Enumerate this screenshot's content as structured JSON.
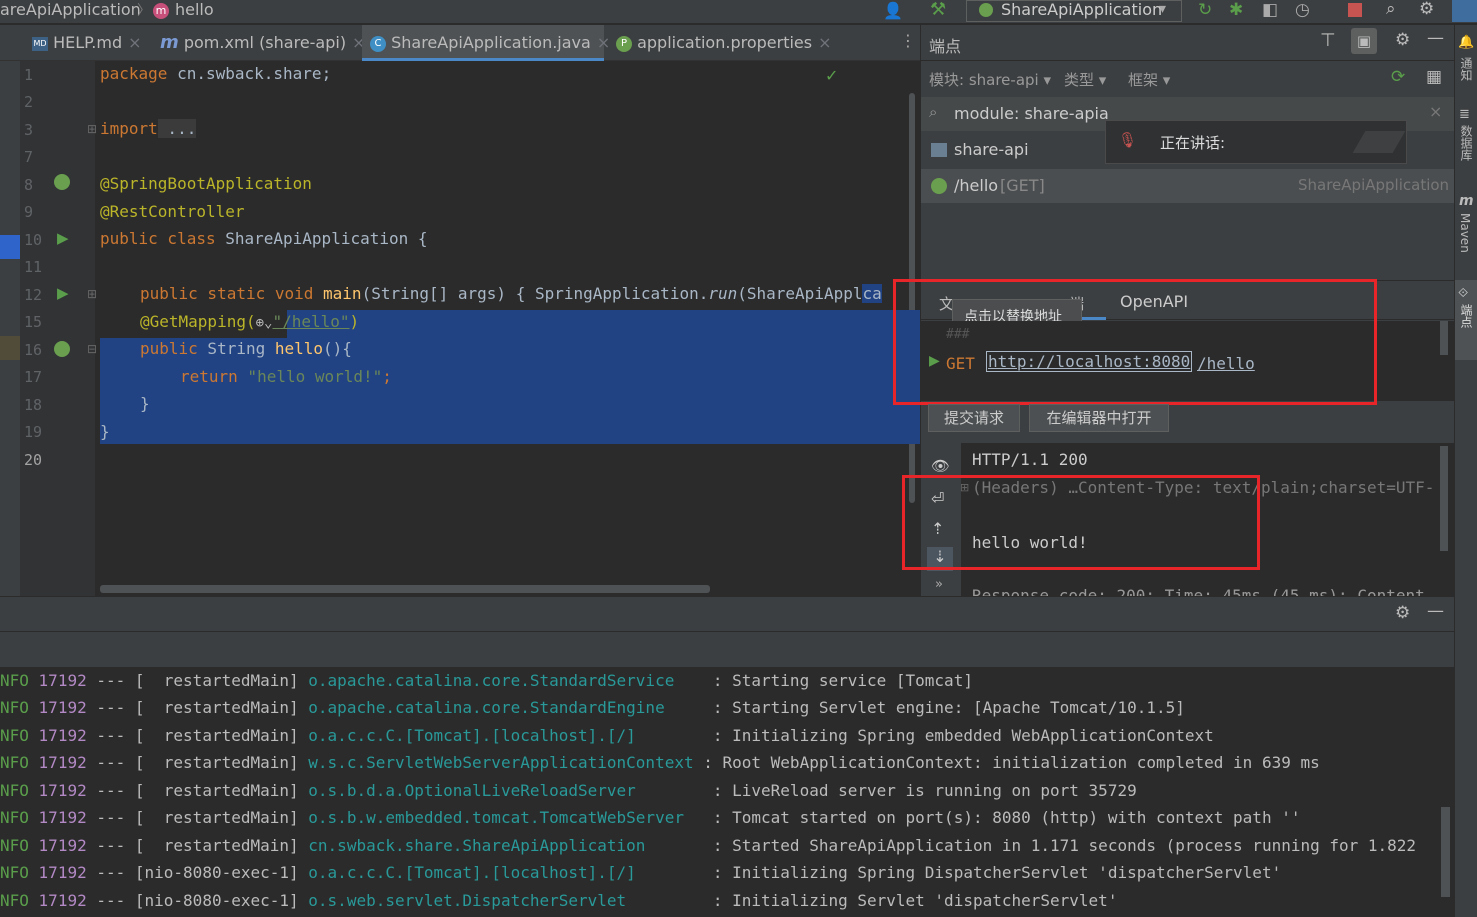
{
  "breadcrumb": {
    "project": "areApiApplication",
    "sep": "〉",
    "method": "hello",
    "method_badge": "m"
  },
  "toolbar": {
    "run_config": "ShareApiApplication",
    "dropdown": "▾"
  },
  "tabs": [
    {
      "label": "HELP.md",
      "icon": "MD"
    },
    {
      "label": "pom.xml (share-api)",
      "icon": "m"
    },
    {
      "label": "ShareApiApplication.java",
      "icon": "C"
    },
    {
      "label": "application.properties",
      "icon": "P"
    }
  ],
  "tab_close": "×",
  "editor": {
    "line_numbers": [
      "1",
      "2",
      "3",
      "7",
      "8",
      "9",
      "10",
      "11",
      "12",
      "15",
      "16",
      "17",
      "18",
      "19",
      "20"
    ],
    "lines": {
      "l1_kw": "package",
      "l1_rest": " cn.swback.share;",
      "l3_kw": "import",
      "l3_rest": " ...",
      "l8": "@SpringBootApplication",
      "l9": "@RestController",
      "l10_kw": "public class",
      "l10_rest": " ShareApiApplication {",
      "l12_kw": "public static void",
      "l12_fn": " main",
      "l12_rest": "(String[] args) { SpringApplication.",
      "l12_run": "run",
      "l12_tail": "(ShareApiAppl",
      "l12_cut": "ca",
      "l15_ann": "@GetMapping(",
      "l15_str": "\"/hello\"",
      "l15_end": ")",
      "l16_kw": "public",
      "l16_rest": " String ",
      "l16_fn": "hello",
      "l16_tail": "(){",
      "l17_kw": "return",
      "l17_str": " \"hello world!\"",
      "l17_end": ";",
      "l18": "}",
      "l19": "}"
    }
  },
  "endpoints": {
    "title": "端点",
    "filters": {
      "module": "模块: share-api",
      "type": "类型",
      "framework": "框架"
    },
    "search": "module: share-apia",
    "tree_module": "share-api",
    "endpoint_path": "/hello",
    "endpoint_method": "[GET]",
    "endpoint_app": "ShareApiApplication",
    "speaking_popup": "正在讲话:",
    "subtabs": [
      "文",
      "端",
      "OpenAPI"
    ],
    "tooltip": "点击以替换地址",
    "hash": "###",
    "request_method": "GET",
    "request_url_host": "http://localhost:8080",
    "request_url_path": "/hello",
    "submit_button": "提交请求",
    "open_in_editor_button": "在编辑器中打开",
    "response_status": "HTTP/1.1 200",
    "response_headers": "(Headers) …Content-Type: text/plain;charset=UTF-",
    "response_body": "hello world!",
    "response_footer": "Response code: 200; Time: 45ms (45 ms); Content",
    "more": "»"
  },
  "right_strip": [
    "通知",
    "数据库",
    "Maven",
    "端点"
  ],
  "console": {
    "lines": [
      {
        "lvl": "NFO",
        "pid": "17192",
        "thread": " --- [  restartedMain] ",
        "cls": "o.apache.catalina.core.StandardService   ",
        "msg": " : Starting service [Tomcat]"
      },
      {
        "lvl": "NFO",
        "pid": "17192",
        "thread": " --- [  restartedMain] ",
        "cls": "o.apache.catalina.core.StandardEngine    ",
        "msg": " : Starting Servlet engine: [Apache Tomcat/10.1.5]"
      },
      {
        "lvl": "NFO",
        "pid": "17192",
        "thread": " --- [  restartedMain] ",
        "cls": "o.a.c.c.C.[Tomcat].[localhost].[/]       ",
        "msg": " : Initializing Spring embedded WebApplicationContext"
      },
      {
        "lvl": "NFO",
        "pid": "17192",
        "thread": " --- [  restartedMain] ",
        "cls": "w.s.c.ServletWebServerApplicationContext ",
        "msg": ": Root WebApplicationContext: initialization completed in 639 ms"
      },
      {
        "lvl": "NFO",
        "pid": "17192",
        "thread": " --- [  restartedMain] ",
        "cls": "o.s.b.d.a.OptionalLiveReloadServer       ",
        "msg": " : LiveReload server is running on port 35729"
      },
      {
        "lvl": "NFO",
        "pid": "17192",
        "thread": " --- [  restartedMain] ",
        "cls": "o.s.b.w.embedded.tomcat.TomcatWebServer  ",
        "msg": " : Tomcat started on port(s): 8080 (http) with context path ''"
      },
      {
        "lvl": "NFO",
        "pid": "17192",
        "thread": " --- [  restartedMain] ",
        "cls": "cn.swback.share.ShareApiApplication      ",
        "msg": " : Started ShareApiApplication in 1.171 seconds (process running for 1.822"
      },
      {
        "lvl": "NFO",
        "pid": "17192",
        "thread": " --- [nio-8080-exec-1] ",
        "cls": "o.a.c.c.C.[Tomcat].[localhost].[/]       ",
        "msg": " : Initializing Spring DispatcherServlet 'dispatcherServlet'"
      },
      {
        "lvl": "NFO",
        "pid": "17192",
        "thread": " --- [nio-8080-exec-1] ",
        "cls": "o.s.web.servlet.DispatcherServlet        ",
        "msg": " : Initializing Servlet 'dispatcherServlet'"
      }
    ]
  },
  "colors": {
    "accent": "#4a88c7",
    "highlight_box": "#e8262a",
    "selection": "#214283"
  }
}
